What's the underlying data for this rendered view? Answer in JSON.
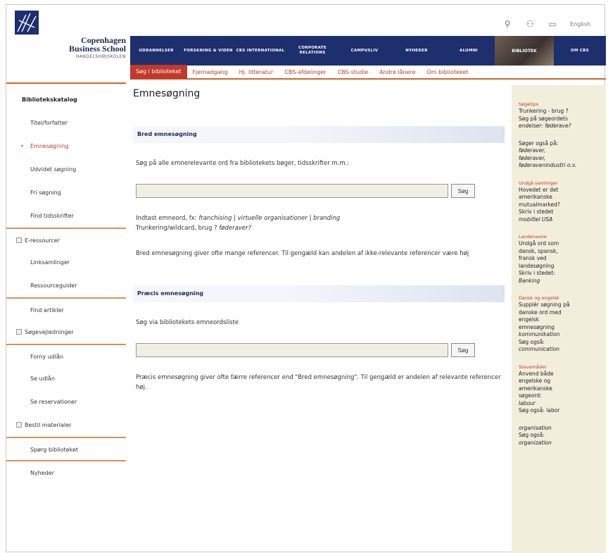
{
  "brand": {
    "name_line1": "Copenhagen",
    "name_line2": "Business School",
    "tagline": "HANDELSHØJSKOLEN"
  },
  "utility": {
    "icons": [
      "search-icon",
      "sitemap-icon",
      "contact-icon"
    ],
    "language": "English"
  },
  "topnav": {
    "items": [
      "UDDANNELSER",
      "FORSKNING & VIDEN",
      "CBS INTERNATIONAL",
      "CORPORATE RELATIONS",
      "CAMPUSLIV",
      "NYHEDER",
      "ALUMNI",
      "BIBLIOTEK",
      "OM CBS"
    ]
  },
  "subnav": {
    "items": [
      "Søg i biblioteket",
      "Fjernadgang",
      "Hj. litteratur",
      "CBS-afdelinger",
      "CBS-studie",
      "Andre lånere",
      "Om biblioteket"
    ]
  },
  "sidebar": {
    "items": [
      {
        "label": "Bibliotekskatalog",
        "kind": "header"
      },
      {
        "label": "Titel/forfatter",
        "kind": "item"
      },
      {
        "label": "Emnesøgning",
        "kind": "active"
      },
      {
        "label": "Udvidet søgning",
        "kind": "item"
      },
      {
        "label": "Fri søgning",
        "kind": "item"
      },
      {
        "label": "Find tidsskrifter",
        "kind": "item"
      },
      {
        "label": "E-ressourcer",
        "kind": "box-sep"
      },
      {
        "label": "Linksamlinger",
        "kind": "item"
      },
      {
        "label": "Ressourceguider",
        "kind": "item"
      },
      {
        "label": "Find artikler",
        "kind": "sep"
      },
      {
        "label": "Søgevejledninger",
        "kind": "box"
      },
      {
        "label": "Forny udlån",
        "kind": "sep"
      },
      {
        "label": "Se udlån",
        "kind": "item"
      },
      {
        "label": "Se reservationer",
        "kind": "item"
      },
      {
        "label": "Bestil materialer",
        "kind": "box"
      },
      {
        "label": "Spørg biblioteket",
        "kind": "sep"
      },
      {
        "label": "Nyheder",
        "kind": "sep"
      }
    ]
  },
  "main": {
    "title": "Emnesøgning",
    "broad": {
      "heading": "Bred emnesøgning",
      "intro": "Søg på alle emnerelevante ord fra bibliotekets bøger, tidsskrifter m.m.:",
      "search_value": "",
      "button": "Søg",
      "help_prefix": "Indtast emneord, fx: ",
      "help_examples": "franchising | virtuelle organisationer | branding",
      "help_trunc": "Trunkering/wildcard, brug ? ",
      "help_trunc_ex": "føderaver?",
      "note": "Bred emnesøgning giver ofte mange referencer. Til gengæld kan andelen af ikke-relevante referencer være høj"
    },
    "precise": {
      "heading": "Præcis emnesøgning",
      "intro": "Søg via bibliotekets emneordsliste",
      "search_value": "",
      "button": "Søg",
      "note": "Præcis emnesøgning giver ofte færre referencer end \"Bred emnesøgning\". Til gengæld er andelen af relevante referencer høj."
    }
  },
  "rightbar": {
    "blocks": [
      {
        "head": "Søgetips",
        "lines": [
          "Trunkering - brug ?",
          "Søg på søgeordets",
          "endelser: føderave?"
        ]
      },
      {
        "head": "",
        "lines": [
          "Søger også på:",
          "føderaver,",
          "føderaver,",
          "føderavenindustri o.v."
        ]
      },
      {
        "head": "Undgå samlinger",
        "lines": [
          "Hovedet er det",
          "amerikanske",
          "mutualmarked?",
          "Skriv i stedet",
          "mobiltel USA"
        ]
      },
      {
        "head": "Landenavne",
        "lines": [
          "Undgå ord som",
          "dansk, spansk,",
          "fransk ved",
          "landesøgning",
          "Skriv i stedet:",
          "Banking"
        ]
      },
      {
        "head": "Dansk og engelsk",
        "lines": [
          "Supplér søgning på",
          "danske ord med",
          "engelsk",
          "emnesøgning",
          "kommunikation",
          "Søg også:",
          "communication"
        ]
      },
      {
        "head": "Stavemåder",
        "lines": [
          "Anvend både",
          "engelske og",
          "amerikanske",
          "søgeord:",
          "labour",
          "Søg også: labor"
        ]
      },
      {
        "head": "",
        "lines": [
          "organisation",
          "Søg også:",
          "organization"
        ]
      }
    ]
  }
}
